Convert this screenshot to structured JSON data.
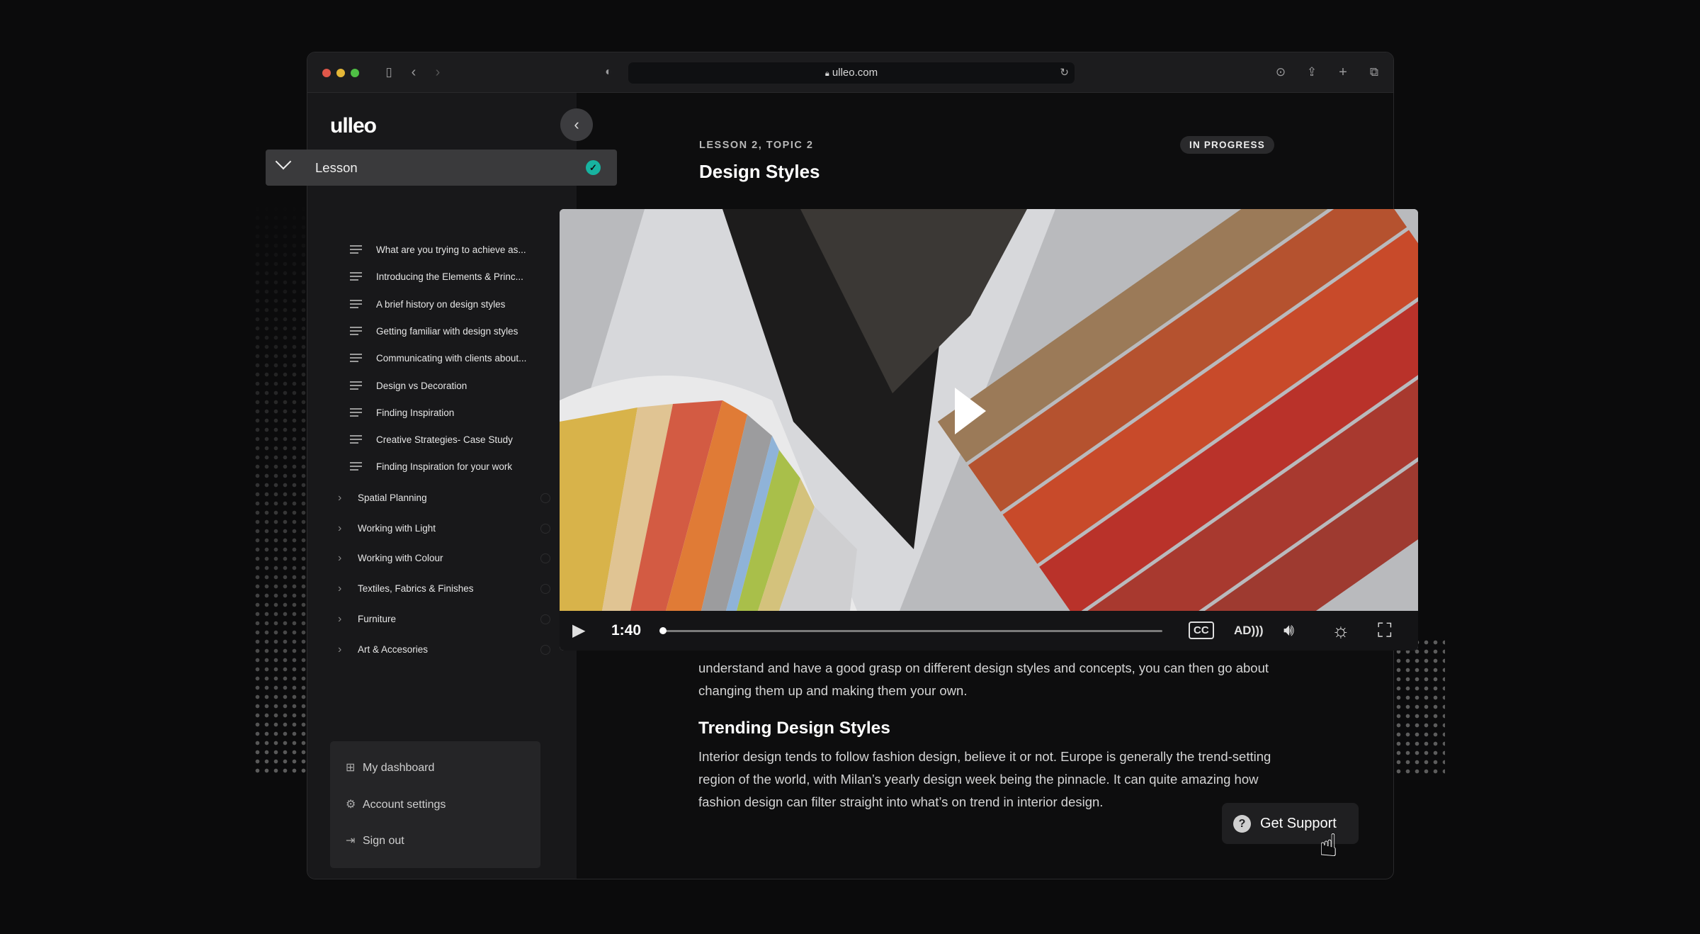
{
  "browser": {
    "url": "ulleo.com",
    "icons": [
      "sidebar-icon",
      "back-icon",
      "forward-icon",
      "shield-icon",
      "lock-icon",
      "reload-icon",
      "download-icon",
      "share-icon",
      "new-tab-icon",
      "tabs-icon"
    ]
  },
  "sidebar": {
    "logo": "ulleo",
    "lesson": {
      "label": "Lesson",
      "status": "completed"
    },
    "topics": [
      {
        "label": "What are you trying to achieve as..."
      },
      {
        "label": "Introducing the Elements & Princ..."
      },
      {
        "label": "A brief history on design styles"
      },
      {
        "label": "Getting familiar with design styles"
      },
      {
        "label": "Communicating with clients about..."
      },
      {
        "label": "Design vs Decoration"
      },
      {
        "label": "Finding Inspiration"
      },
      {
        "label": "Creative Strategies- Case Study"
      },
      {
        "label": "Finding Inspiration for your work"
      }
    ],
    "sections": [
      {
        "label": "Spatial Planning"
      },
      {
        "label": "Working with Light"
      },
      {
        "label": "Working with Colour"
      },
      {
        "label": "Textiles, Fabrics & Finishes"
      },
      {
        "label": "Furniture"
      },
      {
        "label": "Art & Accesories"
      }
    ],
    "menu": [
      {
        "label": "My dashboard",
        "icon": "dashboard-icon"
      },
      {
        "label": "Account settings",
        "icon": "gear-icon"
      },
      {
        "label": "Sign out",
        "icon": "sign-out-icon"
      }
    ],
    "dark_mode": true
  },
  "main": {
    "topic_label": "LESSON 2, TOPIC 2",
    "title": "Design Styles",
    "status_badge": "IN PROGRESS",
    "video": {
      "time": "1:40",
      "progress_percent": 0
    },
    "paragraph1": [
      "understand and have a good grasp on different design styles and concepts, you can then go about",
      "changing them up and making them your own."
    ],
    "heading2": "Trending Design Styles",
    "paragraph2": [
      "Interior design tends to follow fashion design, believe it or not. Europe is generally the trend-setting",
      "region of the world, with Milan’s yearly design week being the pinnacle. It can quite amazing how",
      "fashion design can filter straight into what’s on trend in interior design."
    ],
    "support_button": "Get Support"
  },
  "colors": {
    "accent": "#17b3a0",
    "background": "#0d0d0e",
    "sidebar": "#18181a"
  }
}
